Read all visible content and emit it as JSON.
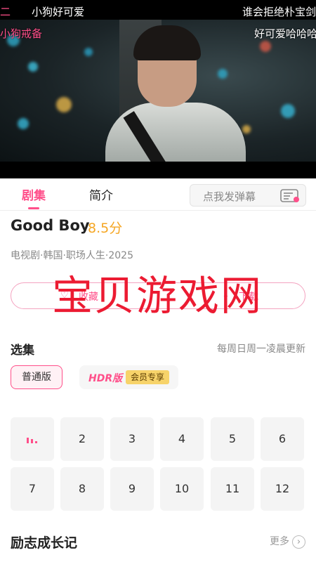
{
  "player": {
    "danmaku": [
      {
        "text": "二",
        "color": "pink"
      },
      {
        "text": "小狗好可爱",
        "color": "white"
      },
      {
        "text": "谁会拒绝朴宝剑",
        "color": "white"
      },
      {
        "text": "小狗戒备",
        "color": "pink"
      },
      {
        "text": "好可爱哈哈哈",
        "color": "white"
      }
    ]
  },
  "tabs": {
    "episodes": "剧集",
    "intro": "简介",
    "danmaku_placeholder": "点我发弹幕"
  },
  "show": {
    "title": "Good Boy",
    "score": "8.5分",
    "meta": "电视剧·韩国·职场人生·2025"
  },
  "actions": {
    "favorite": "收藏",
    "download": "下载"
  },
  "watermark": "宝贝游戏网",
  "episodes": {
    "section_title": "选集",
    "update_note": "每周日周一凌晨更新",
    "version_normal": "普通版",
    "version_hdr": "HDR版",
    "vip_badge": "会员专享",
    "playing_icon": "equalizer-icon",
    "items": [
      "1",
      "2",
      "3",
      "4",
      "5",
      "6",
      "7",
      "8",
      "9",
      "10",
      "11",
      "12"
    ]
  },
  "related": {
    "section_title": "励志成长记",
    "more": "更多"
  },
  "colors": {
    "accent": "#ff4f8a",
    "score": "#f5a623",
    "watermark": "#ec1b32"
  }
}
